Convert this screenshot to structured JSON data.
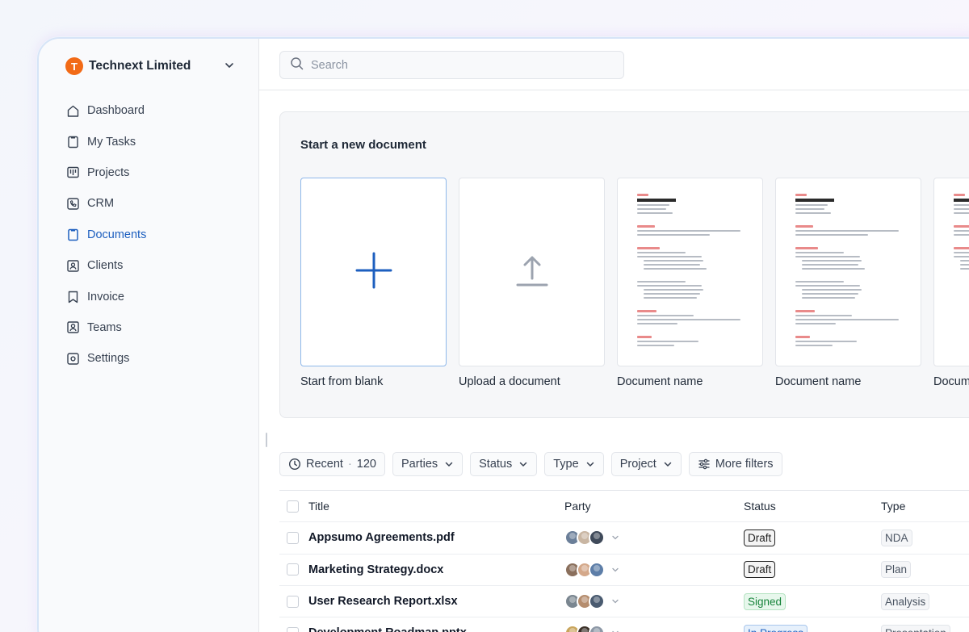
{
  "organization": {
    "initial": "T",
    "name": "Technext Limited",
    "logo_color": "#f26a16"
  },
  "sidebar": {
    "items": [
      {
        "label": "Dashboard",
        "icon": "home-icon"
      },
      {
        "label": "My Tasks",
        "icon": "clipboard-icon"
      },
      {
        "label": "Projects",
        "icon": "kanban-icon"
      },
      {
        "label": "CRM",
        "icon": "phone-icon"
      },
      {
        "label": "Documents",
        "icon": "clipboard-icon",
        "active": true
      },
      {
        "label": "Clients",
        "icon": "contact-icon"
      },
      {
        "label": "Invoice",
        "icon": "bookmark-icon"
      },
      {
        "label": "Teams",
        "icon": "user-icon"
      },
      {
        "label": "Settings",
        "icon": "gear-icon"
      }
    ],
    "active_color": "#1d5fbf"
  },
  "search": {
    "placeholder": "Search"
  },
  "new_document": {
    "title": "Start a new document",
    "cards": [
      {
        "label": "Start from blank",
        "icon": "plus-icon"
      },
      {
        "label": "Upload a document",
        "icon": "upload-icon"
      },
      {
        "label": "Document name",
        "icon": "document-thumbnail"
      },
      {
        "label": "Document name",
        "icon": "document-thumbnail"
      },
      {
        "label": "Document name",
        "icon": "document-thumbnail"
      }
    ]
  },
  "filters": {
    "recent_label": "Recent",
    "recent_count": "120",
    "parties": "Parties",
    "status": "Status",
    "type": "Type",
    "project": "Project",
    "more": "More filters"
  },
  "table": {
    "headers": {
      "title": "Title",
      "party": "Party",
      "status": "Status",
      "type": "Type"
    },
    "rows": [
      {
        "title": "Appsumo Agreements.pdf",
        "status": "Draft",
        "status_kind": "draft",
        "type": "NDA",
        "avatars": [
          "#6b7f99",
          "#c9b6a3",
          "#3f4a5a"
        ]
      },
      {
        "title": "Marketing Strategy.docx",
        "status": "Draft",
        "status_kind": "draft",
        "type": "Plan",
        "avatars": [
          "#8a6f5c",
          "#d4a88a",
          "#5d7ea8"
        ]
      },
      {
        "title": "User Research Report.xlsx",
        "status": "Signed",
        "status_kind": "signed",
        "type": "Analysis",
        "avatars": [
          "#7a8690",
          "#b58d6e",
          "#4a5b70"
        ]
      },
      {
        "title": "Development Roadmap.pptx",
        "status": "In Progress",
        "status_kind": "progress",
        "type": "Presentation",
        "avatars": [
          "#c9a55c",
          "#3b3028",
          "#8d98a6"
        ]
      }
    ]
  }
}
